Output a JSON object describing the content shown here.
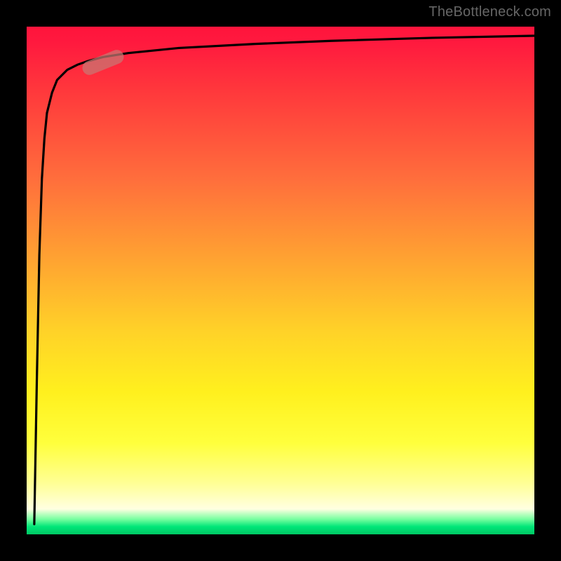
{
  "watermark": "TheBottleneck.com",
  "colors": {
    "background": "#000000",
    "curve": "#000000",
    "marker": "rgba(200,120,115,0.72)",
    "watermark": "#666666"
  },
  "chart_data": {
    "type": "line",
    "title": "",
    "xlabel": "",
    "ylabel": "",
    "xlim": [
      0,
      100
    ],
    "ylim": [
      0,
      100
    ],
    "grid": false,
    "legend": false,
    "background_gradient_stops": [
      {
        "pos": 0,
        "color": "#ff143c"
      },
      {
        "pos": 14,
        "color": "#ff3c3c"
      },
      {
        "pos": 30,
        "color": "#ff6e3c"
      },
      {
        "pos": 45,
        "color": "#ffa032"
      },
      {
        "pos": 60,
        "color": "#ffd228"
      },
      {
        "pos": 72,
        "color": "#fff01e"
      },
      {
        "pos": 82,
        "color": "#ffff3c"
      },
      {
        "pos": 90,
        "color": "#ffff96"
      },
      {
        "pos": 95,
        "color": "#ffffe1"
      },
      {
        "pos": 97,
        "color": "#78ffa0"
      },
      {
        "pos": 100,
        "color": "#00c864"
      }
    ],
    "series": [
      {
        "name": "bottleneck-curve",
        "x": [
          1.5,
          2,
          2.5,
          3,
          3.5,
          4,
          5,
          6,
          8,
          10,
          12,
          15,
          20,
          30,
          45,
          60,
          80,
          100
        ],
        "y": [
          2,
          30,
          55,
          70,
          78,
          83,
          87,
          89.5,
          91.5,
          92.5,
          93.2,
          94,
          94.8,
          95.8,
          96.6,
          97.2,
          97.8,
          98.2
        ]
      }
    ],
    "marker": {
      "x": 15,
      "y": 93,
      "angle_deg": -22
    }
  }
}
